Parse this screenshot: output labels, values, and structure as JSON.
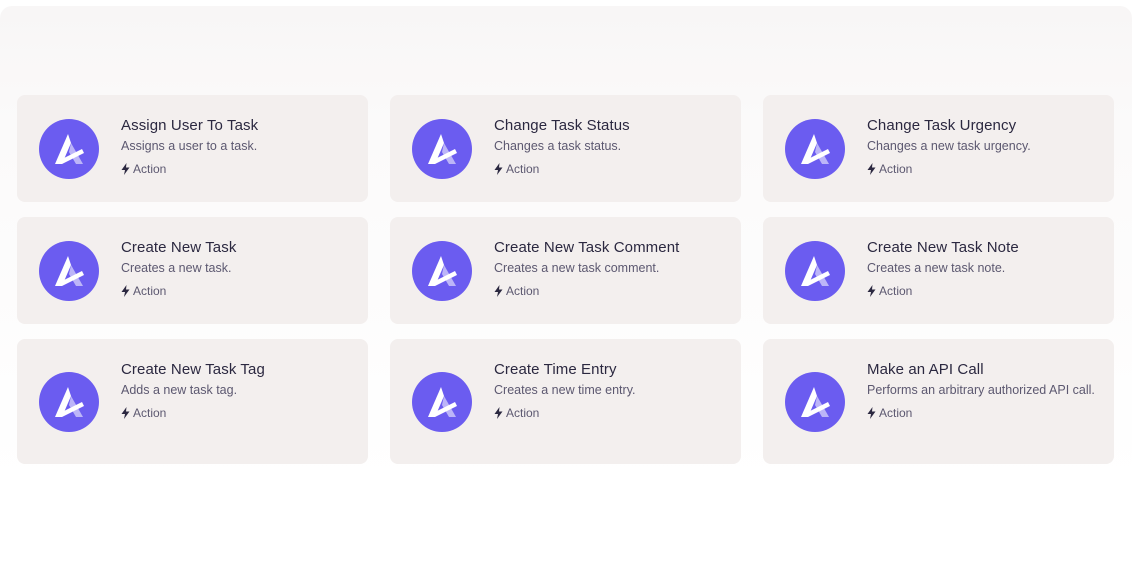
{
  "brand": {
    "logo_color": "#6b5cf0",
    "icon": "app-logo-icon"
  },
  "badge_icon": "lightning-bolt-icon",
  "modules": [
    {
      "title": "Assign User To Task",
      "description": "Assigns a user to a task.",
      "type": "Action"
    },
    {
      "title": "Change Task Status",
      "description": "Changes a task status.",
      "type": "Action"
    },
    {
      "title": "Change Task Urgency",
      "description": "Changes a new task urgency.",
      "type": "Action"
    },
    {
      "title": "Create New Task",
      "description": "Creates a new task.",
      "type": "Action"
    },
    {
      "title": "Create New Task Comment",
      "description": "Creates a new task comment.",
      "type": "Action"
    },
    {
      "title": "Create New Task Note",
      "description": "Creates a new task note.",
      "type": "Action"
    },
    {
      "title": "Create New Task Tag",
      "description": "Adds a new task tag.",
      "type": "Action"
    },
    {
      "title": "Create Time Entry",
      "description": "Creates a new time entry.",
      "type": "Action"
    },
    {
      "title": "Make an API Call",
      "description": "Performs an arbitrary authorized API call.",
      "type": "Action"
    }
  ]
}
